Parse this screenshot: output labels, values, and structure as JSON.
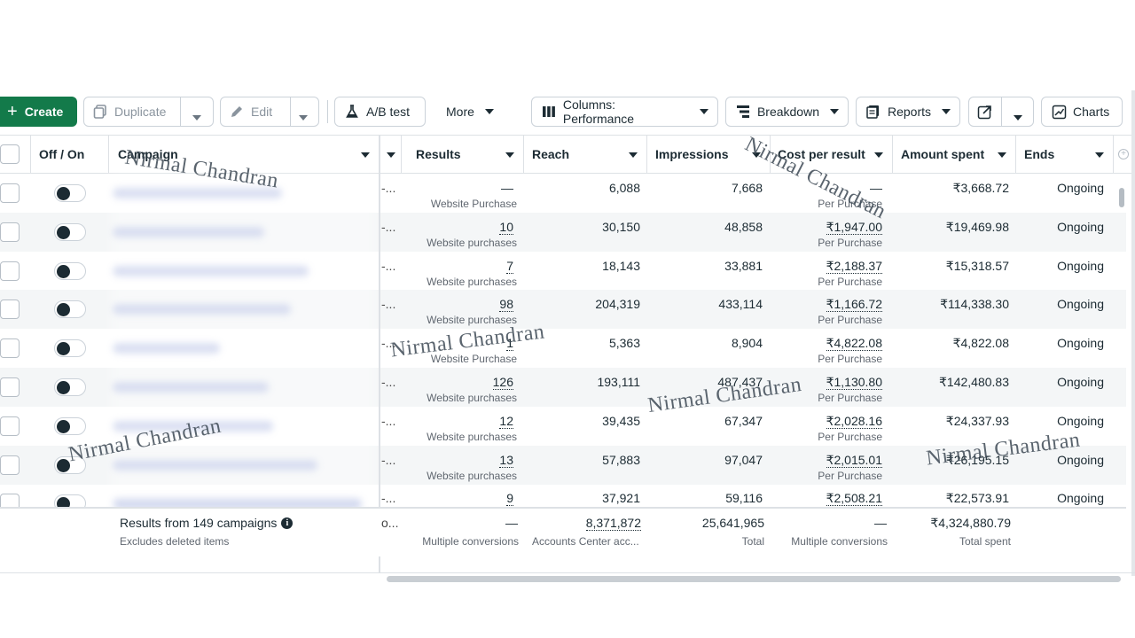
{
  "toolbar": {
    "create_label": "Create",
    "duplicate_label": "Duplicate",
    "edit_label": "Edit",
    "ab_test_label": "A/B test",
    "more_label": "More",
    "columns_label": "Columns: Performance",
    "breakdown_label": "Breakdown",
    "reports_label": "Reports",
    "charts_label": "Charts"
  },
  "columns": {
    "off_on": "Off / On",
    "campaign": "Campaign",
    "results": "Results",
    "reach": "Reach",
    "impressions": "Impressions",
    "cost_per_result": "Cost per result",
    "amount_spent": "Amount spent",
    "ends": "Ends"
  },
  "rows": [
    {
      "delivery": "-...",
      "results": "—",
      "results_sub": "Website Purchase",
      "reach": "6,088",
      "impressions": "7,668",
      "cost": "—",
      "cost_sub": "Per Purchase",
      "spent": "₹3,668.72",
      "ends": "Ongoing"
    },
    {
      "delivery": "-...",
      "results": "10",
      "results_sub": "Website purchases",
      "reach": "30,150",
      "impressions": "48,858",
      "cost": "₹1,947.00",
      "cost_sub": "Per Purchase",
      "spent": "₹19,469.98",
      "ends": "Ongoing"
    },
    {
      "delivery": "-...",
      "results": "7",
      "results_sub": "Website purchases",
      "reach": "18,143",
      "impressions": "33,881",
      "cost": "₹2,188.37",
      "cost_sub": "Per Purchase",
      "spent": "₹15,318.57",
      "ends": "Ongoing"
    },
    {
      "delivery": "-...",
      "results": "98",
      "results_sub": "Website purchases",
      "reach": "204,319",
      "impressions": "433,114",
      "cost": "₹1,166.72",
      "cost_sub": "Per Purchase",
      "spent": "₹114,338.30",
      "ends": "Ongoing"
    },
    {
      "delivery": "-...",
      "results": "1",
      "results_sub": "Website Purchase",
      "reach": "5,363",
      "impressions": "8,904",
      "cost": "₹4,822.08",
      "cost_sub": "Per Purchase",
      "spent": "₹4,822.08",
      "ends": "Ongoing"
    },
    {
      "delivery": "-...",
      "results": "126",
      "results_sub": "Website purchases",
      "reach": "193,111",
      "impressions": "487,437",
      "cost": "₹1,130.80",
      "cost_sub": "Per Purchase",
      "spent": "₹142,480.83",
      "ends": "Ongoing"
    },
    {
      "delivery": "-...",
      "results": "12",
      "results_sub": "Website purchases",
      "reach": "39,435",
      "impressions": "67,347",
      "cost": "₹2,028.16",
      "cost_sub": "Per Purchase",
      "spent": "₹24,337.93",
      "ends": "Ongoing"
    },
    {
      "delivery": "-...",
      "results": "13",
      "results_sub": "Website purchases",
      "reach": "57,883",
      "impressions": "97,047",
      "cost": "₹2,015.01",
      "cost_sub": "Per Purchase",
      "spent": "₹26,195.15",
      "ends": "Ongoing"
    },
    {
      "delivery": "-...",
      "results": "9",
      "results_sub": "",
      "reach": "37,921",
      "impressions": "59,116",
      "cost": "₹2,508.21",
      "cost_sub": "",
      "spent": "₹22,573.91",
      "ends": "Ongoing"
    }
  ],
  "footer": {
    "title": "Results from 149 campaigns",
    "subtitle": "Excludes deleted items",
    "delivery": "o...",
    "results": "—",
    "results_sub": "Multiple conversions",
    "reach": "8,371,872",
    "reach_sub": "Accounts Center acc...",
    "impressions": "25,641,965",
    "impressions_sub": "Total",
    "cost": "—",
    "cost_sub": "Multiple conversions",
    "spent": "₹4,324,880.79",
    "spent_sub": "Total spent"
  },
  "watermark": "Nirmal Chandran",
  "colors": {
    "create_green": "#137a4a",
    "text_dark": "#1c2b33",
    "row_alt": "#f4f6f7",
    "border": "#cbd2d9"
  },
  "icons": [
    "plus-icon",
    "duplicate-icon",
    "pencil-icon",
    "flask-icon",
    "columns-icon",
    "breakdown-icon",
    "reports-icon",
    "export-icon",
    "chart-icon",
    "info-icon",
    "caret-down-icon"
  ]
}
